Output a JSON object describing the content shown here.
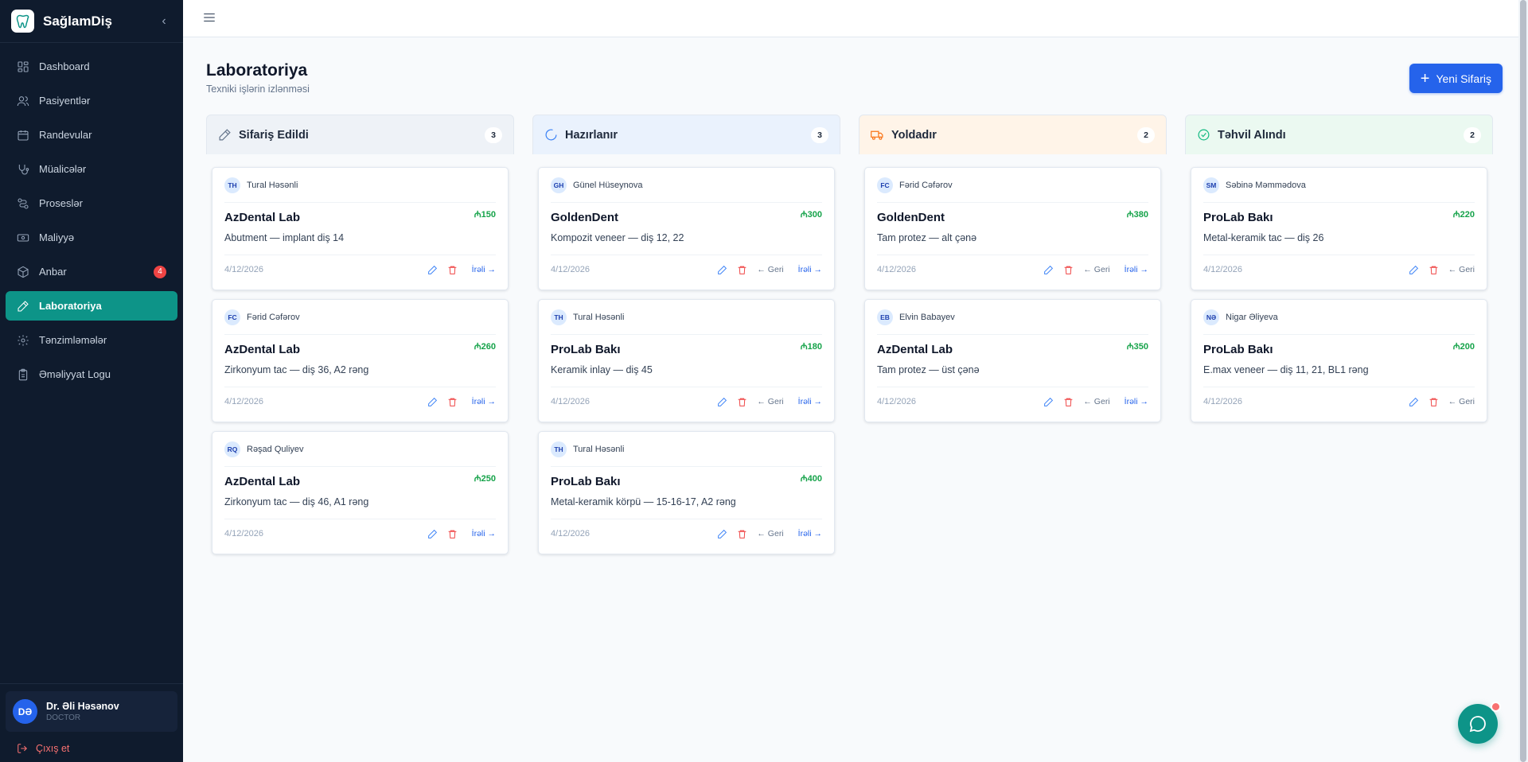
{
  "brand": {
    "name": "SağlamDiş"
  },
  "sidebar": {
    "items": [
      {
        "label": "Dashboard",
        "icon": "grid-icon"
      },
      {
        "label": "Pasiyentlər",
        "icon": "users-icon"
      },
      {
        "label": "Randevular",
        "icon": "calendar-icon"
      },
      {
        "label": "Müalicələr",
        "icon": "stethoscope-icon"
      },
      {
        "label": "Proseslər",
        "icon": "workflow-icon"
      },
      {
        "label": "Maliyyə",
        "icon": "banknote-icon"
      },
      {
        "label": "Anbar",
        "icon": "package-icon",
        "badge": "4"
      },
      {
        "label": "Laboratoriya",
        "icon": "pen-icon",
        "active": true
      },
      {
        "label": "Tənzimləmələr",
        "icon": "gear-icon"
      },
      {
        "label": "Əməliyyat Logu",
        "icon": "clipboard-icon"
      }
    ]
  },
  "user": {
    "initials": "DƏ",
    "name": "Dr. Əli Həsənov",
    "role": "DOCTOR"
  },
  "logout": {
    "label": "Çıxış et"
  },
  "page": {
    "title": "Laboratoriya",
    "subtitle": "Texniki işlərin izlənməsi",
    "new_button": "Yeni Sifariş"
  },
  "actions": {
    "back": "← Geri",
    "forward": "İrəli →"
  },
  "colors": {
    "accent": "#0d9488",
    "primary": "#2563eb",
    "price": "#16a34a",
    "danger": "#ef4444"
  },
  "columns": [
    {
      "title": "Sifariş Edildi",
      "count": "3",
      "icon": "pencil-icon",
      "cards": [
        {
          "initials": "TH",
          "patient": "Tural Həsənli",
          "lab": "AzDental Lab",
          "price": "₼150",
          "desc": "Abutment — implant diş 14",
          "date": "4/12/2026"
        },
        {
          "initials": "FC",
          "patient": "Fərid Cəfərov",
          "lab": "AzDental Lab",
          "price": "₼260",
          "desc": "Zirkonyum tac — diş 36, A2 rəng",
          "date": "4/12/2026"
        },
        {
          "initials": "RQ",
          "patient": "Rəşad Quliyev",
          "lab": "AzDental Lab",
          "price": "₼250",
          "desc": "Zirkonyum tac — diş 46, A1 rəng",
          "date": "4/12/2026"
        }
      ]
    },
    {
      "title": "Hazırlanır",
      "count": "3",
      "icon": "loader-icon",
      "cards": [
        {
          "initials": "GH",
          "patient": "Günel Hüseynova",
          "lab": "GoldenDent",
          "price": "₼300",
          "desc": "Kompozit veneer — diş 12, 22",
          "date": "4/12/2026"
        },
        {
          "initials": "TH",
          "patient": "Tural Həsənli",
          "lab": "ProLab Bakı",
          "price": "₼180",
          "desc": "Keramik inlay — diş 45",
          "date": "4/12/2026"
        },
        {
          "initials": "TH",
          "patient": "Tural Həsənli",
          "lab": "ProLab Bakı",
          "price": "₼400",
          "desc": "Metal-keramik körpü — 15-16-17, A2 rəng",
          "date": "4/12/2026"
        }
      ]
    },
    {
      "title": "Yoldadır",
      "count": "2",
      "icon": "truck-icon",
      "cards": [
        {
          "initials": "FC",
          "patient": "Fərid Cəfərov",
          "lab": "GoldenDent",
          "price": "₼380",
          "desc": "Tam protez — alt çənə",
          "date": "4/12/2026"
        },
        {
          "initials": "EB",
          "patient": "Elvin Babayev",
          "lab": "AzDental Lab",
          "price": "₼350",
          "desc": "Tam protez — üst çənə",
          "date": "4/12/2026"
        }
      ]
    },
    {
      "title": "Təhvil Alındı",
      "count": "2",
      "icon": "check-circle-icon",
      "cards": [
        {
          "initials": "SM",
          "patient": "Səbinə Məmmədova",
          "lab": "ProLab Bakı",
          "price": "₼220",
          "desc": "Metal-keramik tac — diş 26",
          "date": "4/12/2026"
        },
        {
          "initials": "NƏ",
          "patient": "Nigar Əliyeva",
          "lab": "ProLab Bakı",
          "price": "₼200",
          "desc": "E.max veneer — diş 11, 21, BL1 rəng",
          "date": "4/12/2026"
        }
      ]
    }
  ]
}
